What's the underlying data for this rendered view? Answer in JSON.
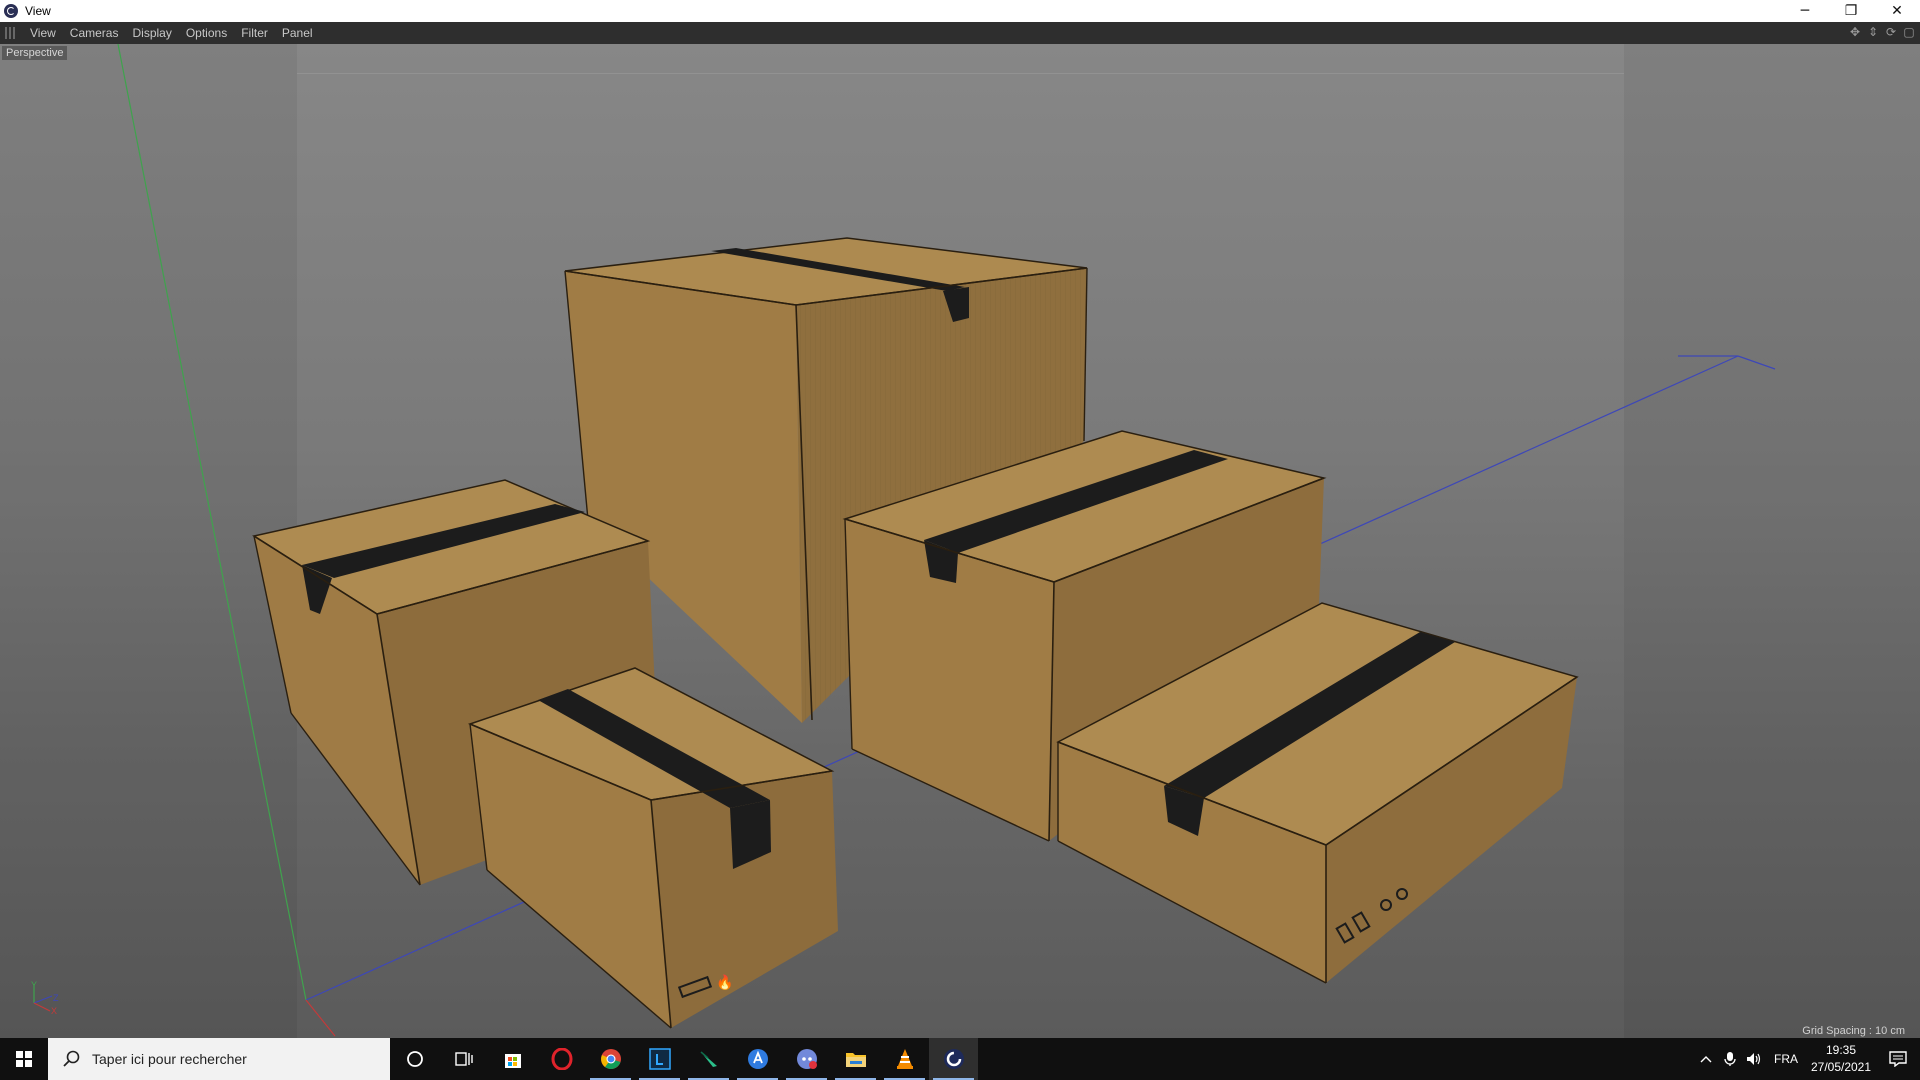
{
  "window": {
    "title": "View",
    "minimize_glyph": "─",
    "restore_glyph": "❐",
    "close_glyph": "✕"
  },
  "menubar": {
    "items": [
      "View",
      "Cameras",
      "Display",
      "Options",
      "Filter",
      "Panel"
    ],
    "tool_icons": [
      "move-view-icon",
      "zoom-view-icon",
      "rotate-view-icon",
      "switch-view-icon"
    ]
  },
  "viewport": {
    "camera_label": "Perspective",
    "grid_spacing": "Grid Spacing : 10 cm",
    "axis_labels": {
      "y": "Y",
      "z": "Z",
      "x": "X"
    },
    "colors": {
      "cardboard_top": "#a8864d",
      "cardboard_front": "#9c7a45",
      "cardboard_side": "#8f6f3e",
      "tape": "#1c1c1c",
      "y_axis": "#3fa34d",
      "z_axis": "#3d47b8",
      "x_axis": "#c23a3a"
    }
  },
  "taskbar": {
    "search_placeholder": "Taper ici pour rechercher",
    "apps": [
      {
        "name": "cortana-icon",
        "open": false
      },
      {
        "name": "task-view-icon",
        "open": false
      },
      {
        "name": "microsoft-store-icon",
        "open": false
      },
      {
        "name": "opera-icon",
        "open": false
      },
      {
        "name": "chrome-icon",
        "open": true
      },
      {
        "name": "lightroom-icon",
        "open": true
      },
      {
        "name": "pen-app-icon",
        "open": true
      },
      {
        "name": "blue-app-icon",
        "open": true
      },
      {
        "name": "discord-icon",
        "open": true
      },
      {
        "name": "file-explorer-icon",
        "open": true
      },
      {
        "name": "vlc-icon",
        "open": true
      },
      {
        "name": "cinema4d-icon",
        "open": true
      }
    ],
    "language": "FRA",
    "time": "19:35",
    "date": "27/05/2021"
  }
}
